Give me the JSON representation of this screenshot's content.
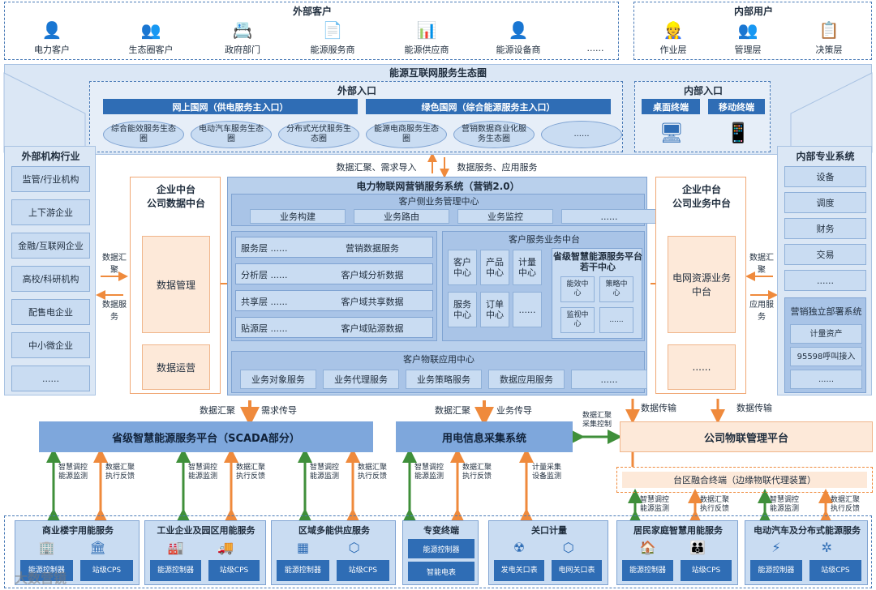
{
  "top": {
    "external_title": "外部客户",
    "internal_title": "内部用户",
    "external_items": [
      {
        "label": "电力客户",
        "icon": "person-location-icon"
      },
      {
        "label": "生态圈客户",
        "icon": "group-icon"
      },
      {
        "label": "政府部门",
        "icon": "id-card-icon"
      },
      {
        "label": "能源服务商",
        "icon": "document-person-icon"
      },
      {
        "label": "能源供应商",
        "icon": "chart-screen-icon"
      },
      {
        "label": "能源设备商",
        "icon": "person-device-icon"
      },
      {
        "label": "......",
        "icon": ""
      }
    ],
    "internal_items": [
      {
        "label": "作业层",
        "icon": "worker-icon"
      },
      {
        "label": "管理层",
        "icon": "team-icon"
      },
      {
        "label": "决策层",
        "icon": "presenter-icon"
      }
    ]
  },
  "eco": {
    "title": "能源互联网服务生态圈",
    "ext_entry_title": "外部入口",
    "wsgw": "网上国网（供电服务主入口）",
    "green": "绿色国网（综合能源服务主入口）",
    "ellipses": [
      "综合能效服务生态圈",
      "电动汽车服务生态圈",
      "分布式光伏服务生态圈",
      "能源电商服务生态圈",
      "营销数据商业化服务生态圈",
      "......"
    ],
    "int_entry_title": "内部入口",
    "desktop": "桌面终端",
    "mobile": "移动终端"
  },
  "left_ext": {
    "title": "外部机构行业",
    "items": [
      "监管/行业机构",
      "上下游企业",
      "金融/互联网企业",
      "高校/科研机构",
      "配售电企业",
      "中小微企业",
      "......"
    ],
    "arrow_top": "数据汇聚",
    "arrow_bottom": "数据服务"
  },
  "left_mid": {
    "title": "企业中台\n公司数据中台",
    "box1": "数据管理",
    "box2": "数据运营"
  },
  "right_mid": {
    "title": "企业中台\n公司业务中台",
    "box1": "电网资源业务中台",
    "box2": "......"
  },
  "right_int": {
    "title": "内部专业系统",
    "items": [
      "设备",
      "调度",
      "财务",
      "交易",
      "......"
    ],
    "market_title": "营销独立部署系统",
    "market_items": [
      "计量资产",
      "95598呼叫接入",
      "......"
    ],
    "arrow_top": "数据汇聚",
    "arrow_bottom": "应用服务"
  },
  "center": {
    "flow_left": "数据汇聚、需求导入",
    "flow_right": "数据服务、应用服务",
    "title": "电力物联网营销服务系统（营销2.0）",
    "bizmgmt_title": "客户侧业务管理中心",
    "bizmgmt_items": [
      "业务构建",
      "业务路由",
      "业务监控",
      "......"
    ],
    "layers": [
      {
        "name": "服务层 ......",
        "value": "营销数据服务"
      },
      {
        "name": "分析层 ......",
        "value": "客户域分析数据"
      },
      {
        "name": "共享层 ......",
        "value": "客户域共享数据"
      },
      {
        "name": "贴源层 ......",
        "value": "客户域贴源数据"
      }
    ],
    "csb_title": "客户服务业务中台",
    "csb_items": [
      "客户中心",
      "产品中心",
      "计量中心",
      "服务中心",
      "订单中心",
      "......"
    ],
    "prov_title": "省级智慧能源服务平台若干中心",
    "prov_items": [
      "能效中心",
      "策略中心",
      "监视中心",
      "......"
    ],
    "iot_title": "客户物联应用中心",
    "iot_items": [
      "业务对象服务",
      "业务代理服务",
      "业务策略服务",
      "数据应用服务",
      "......"
    ]
  },
  "mid_flows": {
    "a_left": "数据汇聚",
    "a_right": "需求传导",
    "b_left": "数据汇聚",
    "b_right": "业务传导",
    "c_left": "数据传输",
    "c_right": "数据传输",
    "h_label": "数据汇聚\n采集控制"
  },
  "platforms": {
    "scada": "省级智慧能源服务平台（SCADA部分）",
    "collect": "用电信息采集系统",
    "iotmgmt": "公司物联管理平台",
    "edge": "台区融合终端（边缘物联代理装置）"
  },
  "lower_flows": {
    "green": "智慧调控能源监测",
    "orange": "数据汇聚执行反馈",
    "meter": "计量采集设备监测"
  },
  "bottom": [
    {
      "title": "商业楼宇用能服务",
      "icons": [
        "building-icon",
        "bank-icon"
      ],
      "boxes": [
        "能源控制器",
        "站级CPS"
      ]
    },
    {
      "title": "工业企业及园区用能服务",
      "icons": [
        "factory-icon",
        "truck-icon"
      ],
      "boxes": [
        "能源控制器",
        "站级CPS"
      ]
    },
    {
      "title": "区域多能供应服务",
      "icons": [
        "solar-panel-icon",
        "network-icon"
      ],
      "boxes": [
        "能源控制器",
        "站级CPS"
      ]
    },
    {
      "title": "专变终端",
      "icons": [],
      "boxes": [
        "能源控制器",
        "智能电表"
      ]
    },
    {
      "title": "关口计量",
      "icons": [
        "power-plant-icon",
        "grid-icon"
      ],
      "boxes": [
        "发电关口表",
        "电网关口表"
      ]
    },
    {
      "title": "居民家庭智慧用能服务",
      "icons": [
        "house-icon",
        "family-icon"
      ],
      "boxes": [
        "能源控制器",
        "站级CPS"
      ]
    },
    {
      "title": "电动汽车及分布式能源服务",
      "icons": [
        "charger-icon",
        "windmill-icon"
      ],
      "boxes": [
        "能源控制器",
        "站级CPS"
      ]
    }
  ],
  "watermark": "大数营镜",
  "colors": {
    "blue": "#2f6db5",
    "orange": "#ef8a3c",
    "green": "#3f8f3a",
    "light": "#dbe7f5"
  }
}
